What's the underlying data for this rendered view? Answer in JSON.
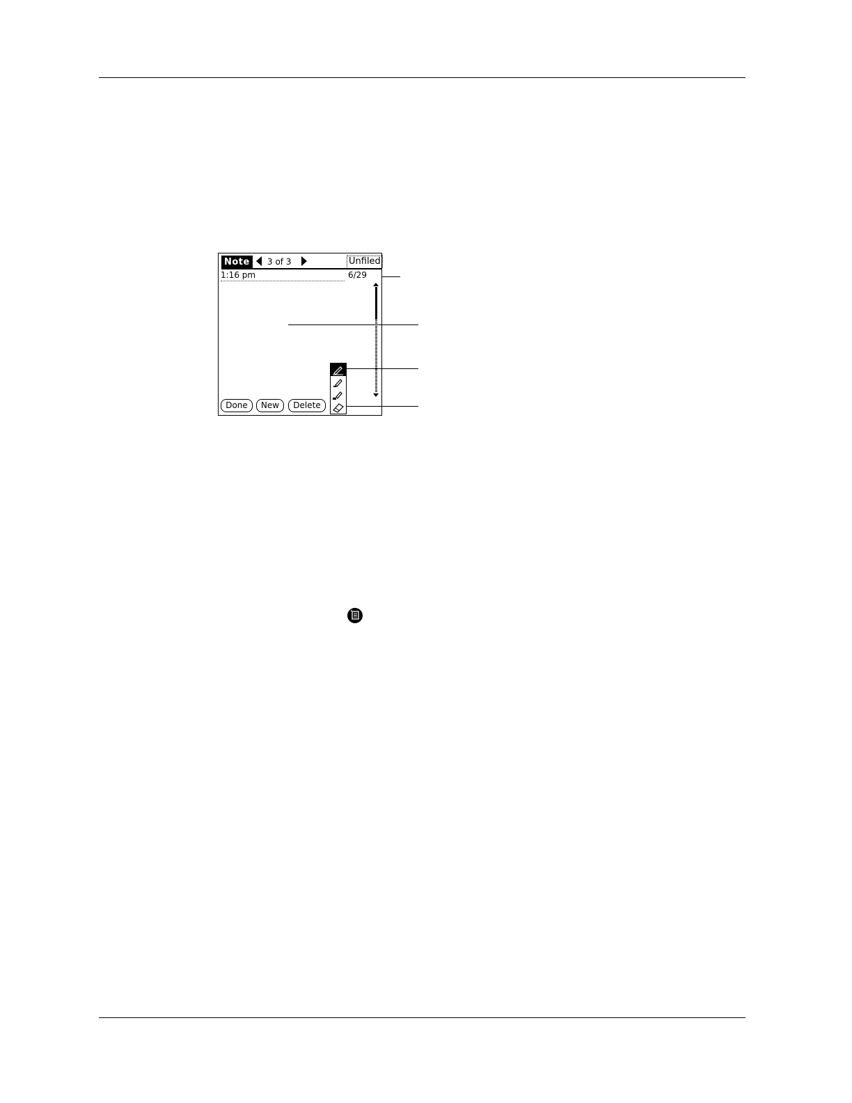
{
  "screen": {
    "title": "Note",
    "record_count": "3 of 3",
    "category": "Unfiled",
    "time": "1:16 pm",
    "date": "6/29",
    "scroll_position_fraction": 0.0,
    "scroll_thumb_fraction": 0.3
  },
  "buttons": {
    "done": "Done",
    "new": "New",
    "delete": "Delete"
  },
  "palette": {
    "tools": [
      "fine-pen-icon",
      "medium-pen-icon",
      "bold-pen-icon",
      "eraser-icon"
    ],
    "selected_tool": "fine-pen-icon"
  },
  "inline_icon": "memo-pad-icon"
}
